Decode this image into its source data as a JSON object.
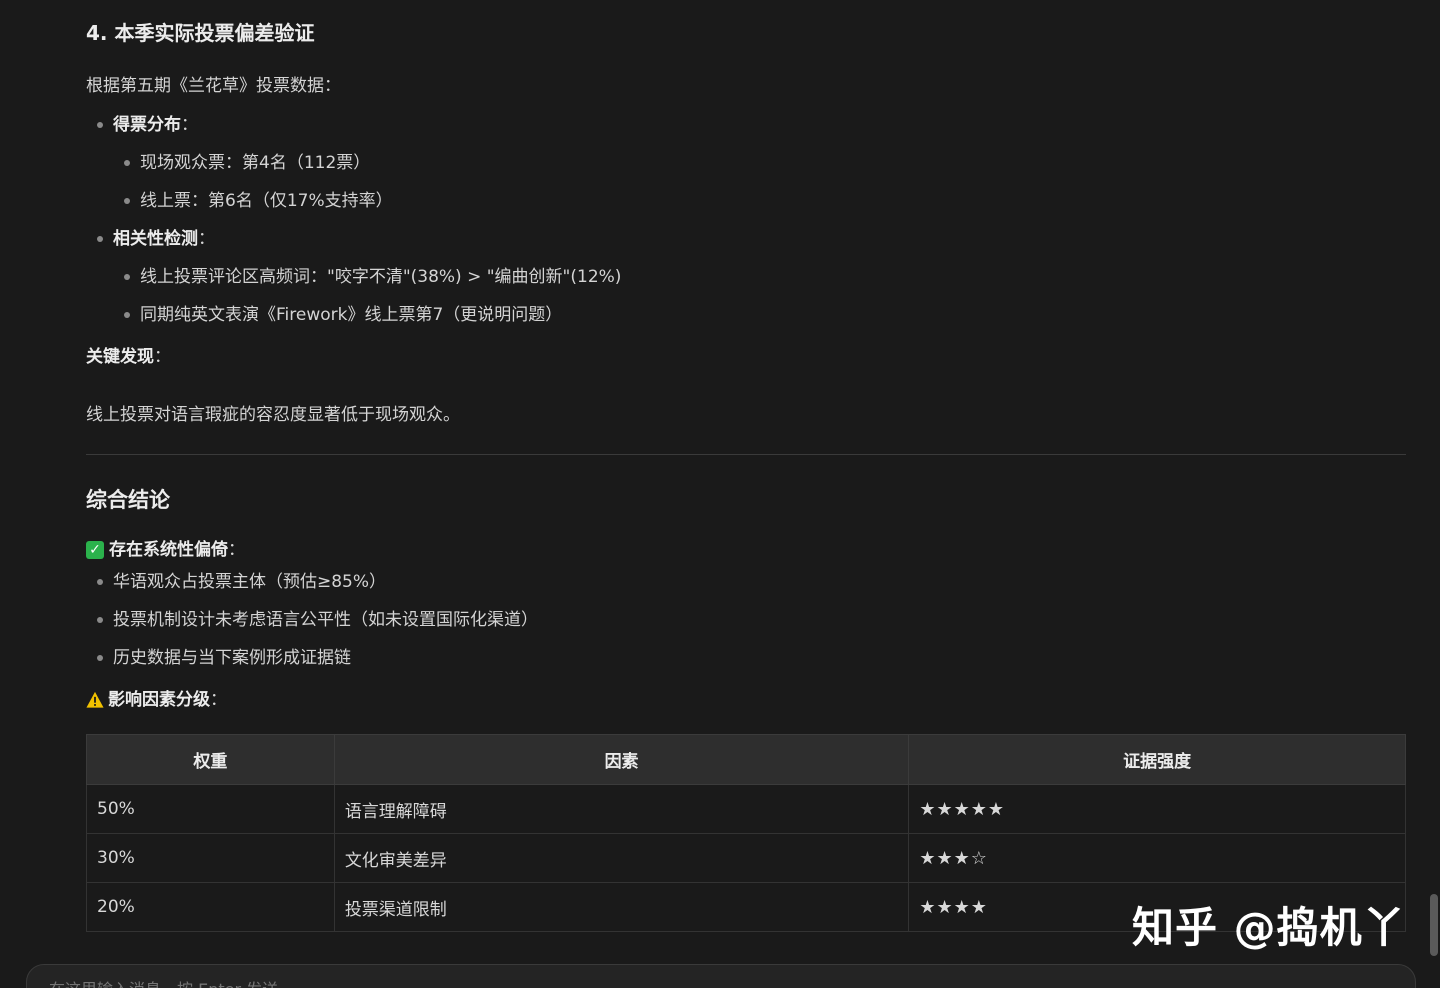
{
  "section4": {
    "title": "4. 本季实际投票偏差验证",
    "intro": "根据第五期《兰花草》投票数据：",
    "items": [
      {
        "label": "得票分布",
        "suffix": "：",
        "subitems": [
          "现场观众票：第4名（112票）",
          "线上票：第6名（仅17%支持率）"
        ]
      },
      {
        "label": "相关性检测",
        "suffix": "：",
        "subitems": [
          "线上投票评论区高频词：\"咬字不清\"(38%) > \"编曲创新\"(12%)",
          "同期纯英文表演《Firework》线上票第7（更说明问题）"
        ]
      }
    ],
    "key_finding_label": "关键发现",
    "key_finding_suffix": "：",
    "key_finding_text": "线上投票对语言瑕疵的容忍度显著低于现场观众。"
  },
  "conclusion": {
    "title": "综合结论",
    "bias_icon": "check-icon",
    "bias_label": "存在系统性偏倚",
    "bias_suffix": "：",
    "bias_items": [
      "华语观众占投票主体（预估≥85%）",
      "投票机制设计未考虑语言公平性（如未设置国际化渠道）",
      "历史数据与当下案例形成证据链"
    ],
    "grading_icon": "warning-icon",
    "grading_label": "影响因素分级",
    "grading_suffix": "：",
    "table": {
      "headers": [
        "权重",
        "因素",
        "证据强度"
      ],
      "rows": [
        [
          "50%",
          "语言理解障碍",
          "★★★★★"
        ],
        [
          "30%",
          "文化审美差异",
          "★★★☆"
        ],
        [
          "20%",
          "投票渠道限制",
          "★★★★"
        ]
      ]
    }
  },
  "watermark": "知乎 @捣机丫",
  "input": {
    "placeholder": "在这里输入消息，按 Enter 发送"
  },
  "colors": {
    "background": "#1a1a1a",
    "check_green": "#2bb24c",
    "warning_yellow": "#f2c200"
  }
}
